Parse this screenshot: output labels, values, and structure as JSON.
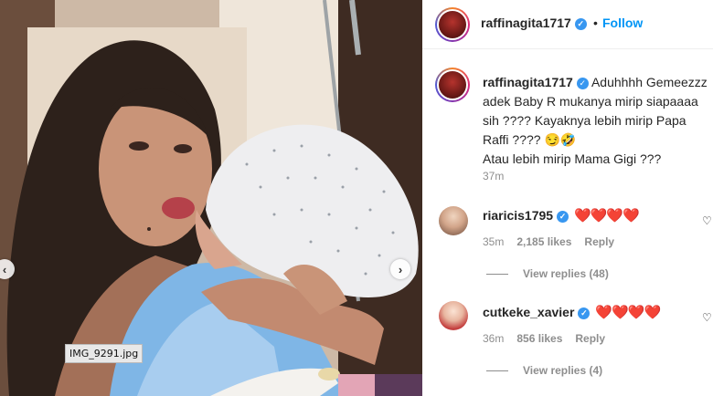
{
  "post": {
    "image_filename": "IMG_9291.jpg",
    "prev_icon": "chevron-left-icon",
    "next_icon": "chevron-right-icon"
  },
  "header": {
    "username": "raffinagita1717",
    "dot": "•",
    "follow_label": "Follow"
  },
  "caption": {
    "username": "raffinagita1717",
    "text_line1": "Aduhhhh Gemeezzz adek Baby R mukanya mirip siapaaaa sih ???? Kayaknya lebih mirip Papa Raffi ???? 😏🤣",
    "text_line2": "Atau lebih mirip Mama Gigi ???",
    "time": "37m"
  },
  "comments": [
    {
      "username": "riaricis1795",
      "text": "❤️❤️❤️❤️",
      "time": "35m",
      "likes": "2,185 likes",
      "reply_label": "Reply",
      "view_replies": "View replies (48)"
    },
    {
      "username": "cutkeke_xavier",
      "text": "❤️❤️❤️❤️",
      "time": "36m",
      "likes": "856 likes",
      "reply_label": "Reply",
      "view_replies": "View replies (4)"
    }
  ],
  "colors": {
    "accent": "#0095f6",
    "verified": "#3897f0",
    "heart": "#ed1f30",
    "muted": "#8e8e8e"
  }
}
